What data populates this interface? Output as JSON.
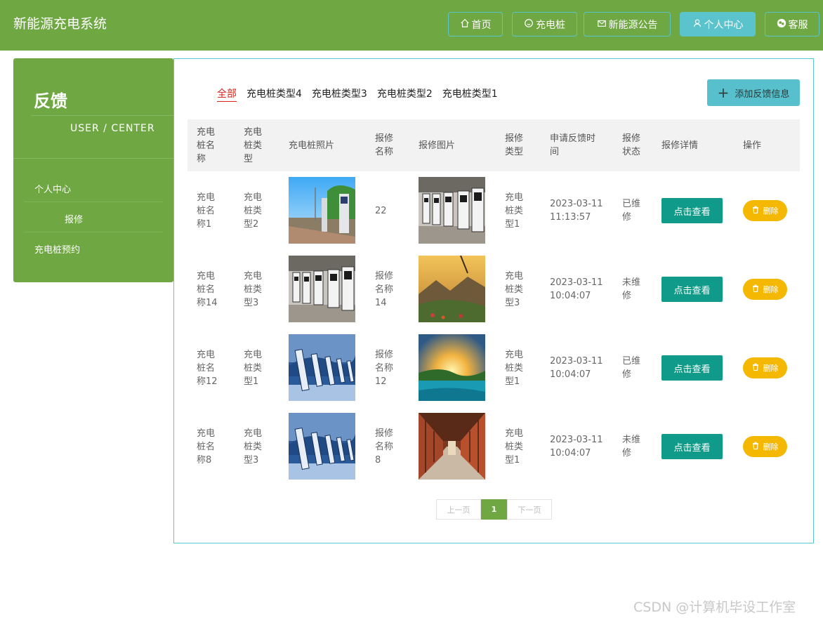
{
  "header": {
    "brand": "新能源充电系统",
    "nav": [
      {
        "label": "首页",
        "icon": "home-icon"
      },
      {
        "label": "充电桩",
        "icon": "circle-icon"
      },
      {
        "label": "新能源公告",
        "icon": "mail-icon"
      },
      {
        "label": "个人中心",
        "icon": "user-icon",
        "active": true
      },
      {
        "label": "客服",
        "icon": "chat-icon"
      }
    ]
  },
  "sidebar": {
    "title": "反馈",
    "subtitle": "USER / CENTER",
    "items": [
      {
        "label": "个人中心"
      },
      {
        "label": "报修"
      },
      {
        "label": "充电桩预约"
      }
    ]
  },
  "tabs": [
    {
      "label": "全部",
      "active": true
    },
    {
      "label": "充电桩类型4"
    },
    {
      "label": "充电桩类型3"
    },
    {
      "label": "充电桩类型2"
    },
    {
      "label": "充电桩类型1"
    }
  ],
  "add_button": "添加反馈信息",
  "table": {
    "headers": [
      "充电桩名称",
      "充电桩类型",
      "充电桩照片",
      "报修名称",
      "报修图片",
      "报修类型",
      "申请反馈时间",
      "报修状态",
      "报修详情",
      "操作"
    ],
    "rows": [
      {
        "name": "充电桩名称1",
        "type": "充电桩类型2",
        "photo": "charger-sunny",
        "repair_name": "22",
        "repair_img": "charger-indoor",
        "repair_type": "充电桩类型1",
        "time": "2023-03-11 11:13:57",
        "status": "已维修",
        "view": "点击查看",
        "delete": "删除"
      },
      {
        "name": "充电桩名称14",
        "type": "充电桩类型3",
        "photo": "charger-indoor",
        "repair_name": "报修名称14",
        "repair_img": "mountain-sunset",
        "repair_type": "充电桩类型3",
        "time": "2023-03-11 10:04:07",
        "status": "未维修",
        "view": "点击查看",
        "delete": "删除"
      },
      {
        "name": "充电桩名称12",
        "type": "充电桩类型1",
        "photo": "charger-blue",
        "repair_name": "报修名称12",
        "repair_img": "lake-sunrise",
        "repair_type": "充电桩类型1",
        "time": "2023-03-11 10:04:07",
        "status": "已维修",
        "view": "点击查看",
        "delete": "删除"
      },
      {
        "name": "充电桩名称8",
        "type": "充电桩类型3",
        "photo": "charger-blue",
        "repair_name": "报修名称8",
        "repair_img": "red-corridor",
        "repair_type": "充电桩类型1",
        "time": "2023-03-11 10:04:07",
        "status": "未维修",
        "view": "点击查看",
        "delete": "删除"
      }
    ]
  },
  "pager": {
    "prev": "上一页",
    "current": "1",
    "next": "下一页"
  },
  "watermark": "CSDN @计算机毕设工作室",
  "colors": {
    "brand_green": "#6fa842",
    "accent_teal": "#5bc3cb",
    "view_button": "#0f9a89",
    "delete_button": "#f5b800",
    "active_tab": "#d9261c"
  }
}
